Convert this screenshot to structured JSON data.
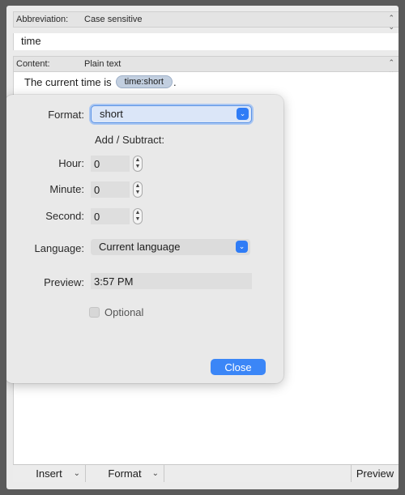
{
  "abbreviation": {
    "label": "Abbreviation:",
    "mode": "Case sensitive",
    "value": "time"
  },
  "content": {
    "label": "Content:",
    "mode": "Plain text",
    "text_before": "The current time is",
    "token": "time:short",
    "text_after": "."
  },
  "popover": {
    "format_label": "Format:",
    "format_value": "short",
    "add_subtract_label": "Add / Subtract:",
    "hour_label": "Hour:",
    "hour_value": "0",
    "minute_label": "Minute:",
    "minute_value": "0",
    "second_label": "Second:",
    "second_value": "0",
    "language_label": "Language:",
    "language_value": "Current language",
    "preview_label": "Preview:",
    "preview_value": "3:57 PM",
    "optional_label": "Optional",
    "optional_checked": false,
    "close_label": "Close"
  },
  "bottom_bar": {
    "insert_label": "Insert",
    "format_label": "Format",
    "preview_label": "Preview"
  },
  "icons": {
    "updown": "up-down-chevron-icon",
    "dropdown": "chevron-down-icon"
  },
  "colors": {
    "accent": "#2f7cf6",
    "token_bg": "#c2cfe0",
    "popover_bg": "#e9e9e9"
  }
}
